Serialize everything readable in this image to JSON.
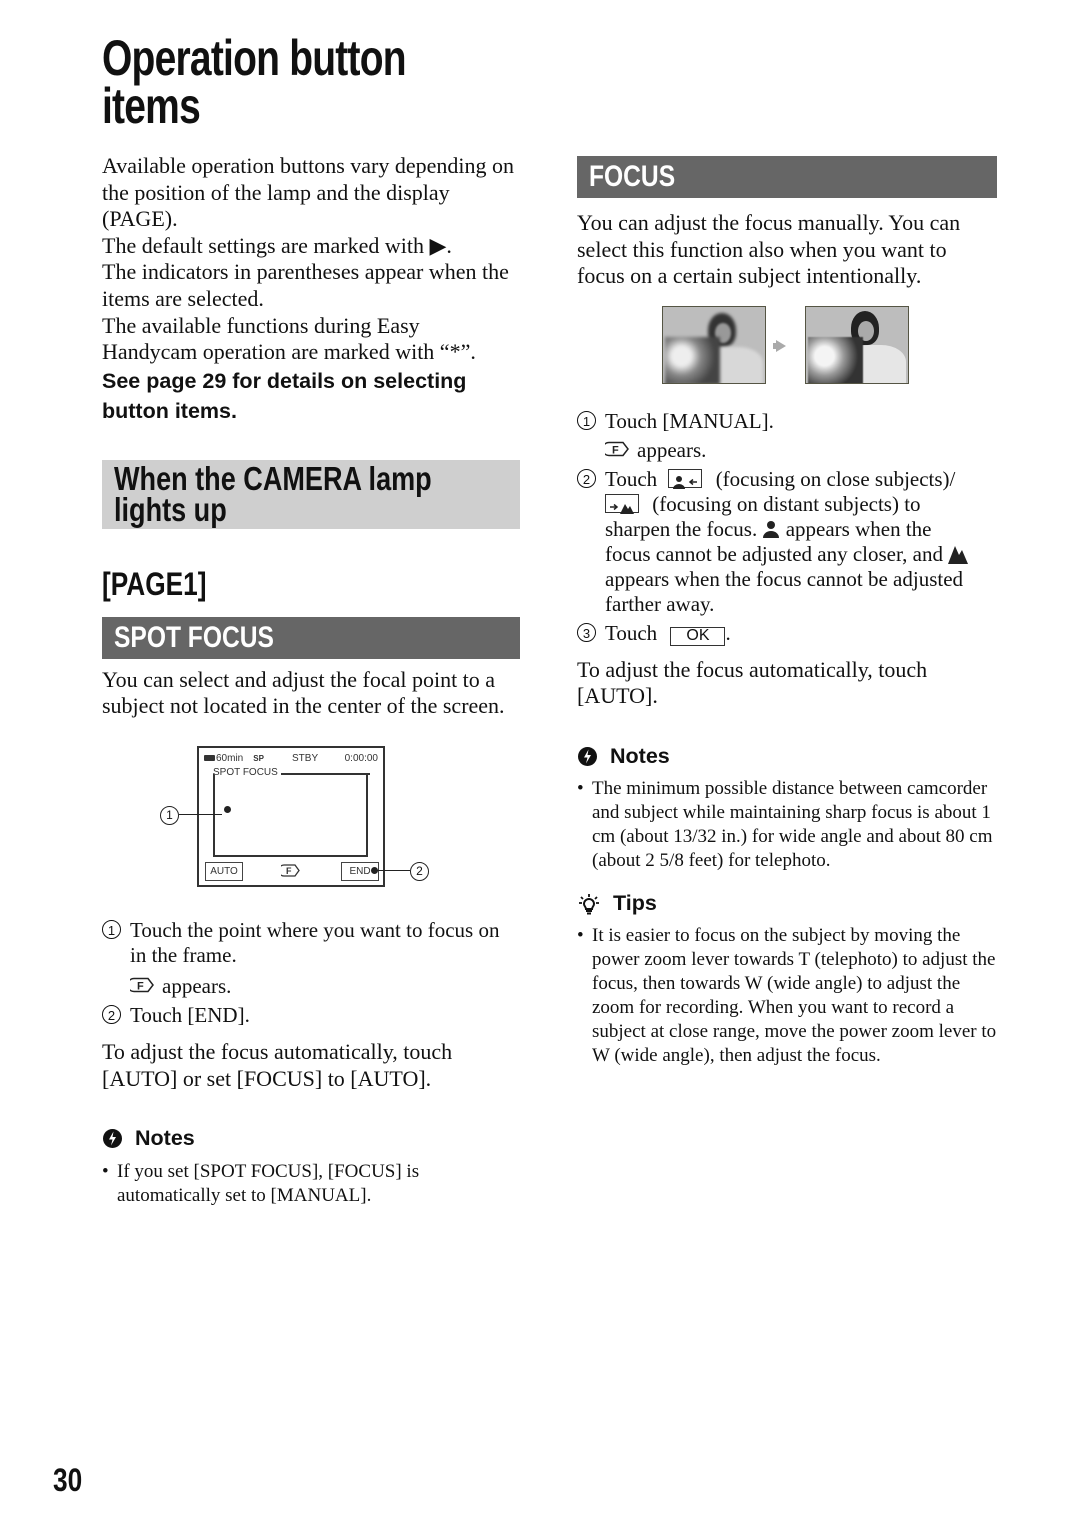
{
  "page": {
    "title_line1": "Operation button",
    "title_line2": "items",
    "page_number": "30"
  },
  "intro": {
    "paragraphs": [
      "Available operation buttons vary depending on the position of the lamp and the display (PAGE).",
      "The default settings are marked with ▶.",
      "The indicators in parentheses appear when the items are selected.",
      "The available functions during Easy Handycam operation are marked with “*”."
    ],
    "bold_note": "See page 29 for details on selecting button items."
  },
  "section": {
    "title": "When the CAMERA lamp lights up",
    "page_label": "[PAGE1]"
  },
  "spot_focus": {
    "heading": "SPOT FOCUS",
    "description": "You can select and adjust the focal point to a subject not located in the center of the screen.",
    "lcd": {
      "battery": "60min",
      "status": "STBY",
      "timecode": "0:00:00",
      "frame_label": "SPOT FOCUS",
      "auto_button": "AUTO",
      "end_button": "END",
      "callout_1": "1",
      "callout_2": "2"
    },
    "steps": [
      {
        "num": "1",
        "text": "Touch the point where you want to focus on in the frame.",
        "sub": "appears."
      },
      {
        "num": "2",
        "text": "Touch [END]."
      }
    ],
    "auto_text": "To adjust the focus automatically, touch [AUTO] or set [FOCUS] to [AUTO].",
    "notes_title": "Notes",
    "notes": [
      "If you set [SPOT FOCUS], [FOCUS] is automatically set to [MANUAL]."
    ]
  },
  "focus": {
    "heading": "FOCUS",
    "description": "You can adjust the focus manually. You can select this function also when you want to focus on a certain subject intentionally.",
    "steps": {
      "s1_num": "1",
      "s1_text": "Touch [MANUAL].",
      "s1_sub": "appears.",
      "s2_num": "2",
      "s2_touch": "Touch",
      "s2_close": "(focusing on close subjects)/",
      "s2_distant": "(focusing on distant subjects) to",
      "s2_line3a": "sharpen the focus.",
      "s2_line3b": "appears when the",
      "s2_line4": "focus cannot be adjusted any closer, and",
      "s2_line5": "appears when the focus cannot be adjusted",
      "s2_line6": "farther away.",
      "s3_num": "3",
      "s3_touch": "Touch",
      "s3_ok": "OK",
      "s3_end": "."
    },
    "auto_text": "To adjust the focus automatically, touch [AUTO].",
    "notes_title": "Notes",
    "notes": [
      "The minimum possible distance between camcorder and subject while maintaining sharp focus is about 1 cm (about 13/32 in.) for wide angle and about 80 cm (about 2 5/8 feet) for telephoto."
    ],
    "tips_title": "Tips",
    "tips": [
      "It is easier to focus on the subject by moving the power zoom lever towards T (telephoto) to adjust the focus, then towards W (wide angle) to adjust the zoom for recording. When you want to record a subject at close range, move the power zoom lever to W (wide angle), then adjust the focus."
    ]
  },
  "colors": {
    "dark_bar": "#666666",
    "light_bar": "#cfcfcf",
    "text": "#111111"
  }
}
